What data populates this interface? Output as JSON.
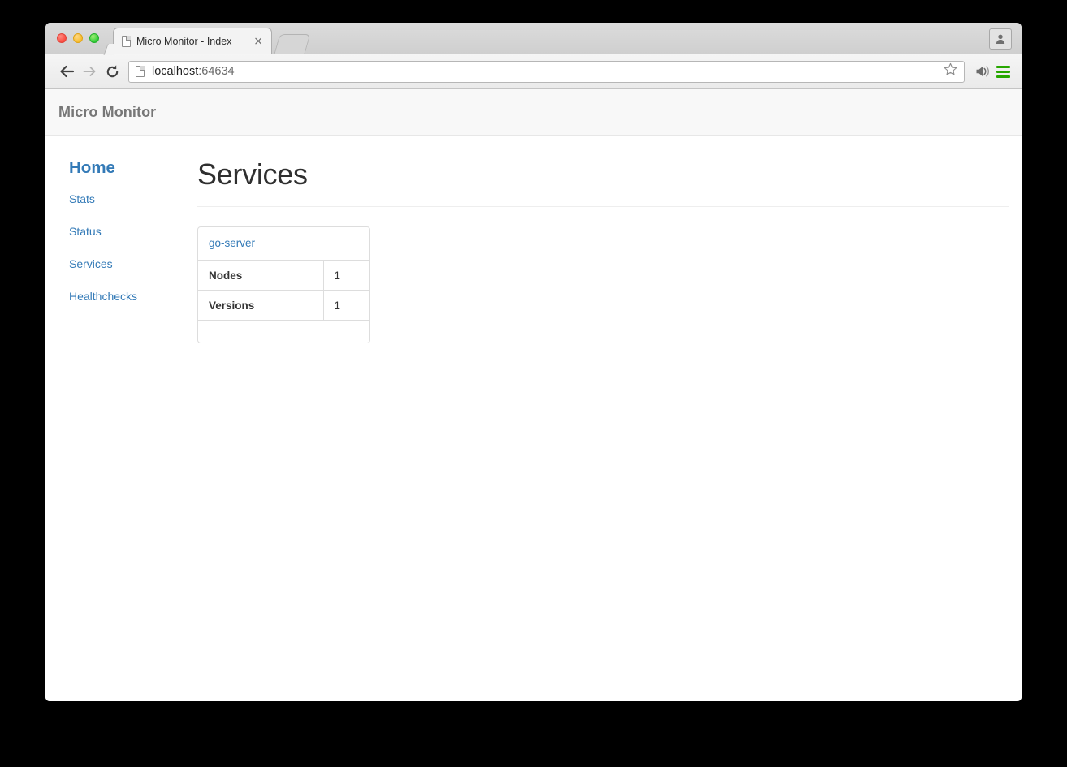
{
  "browser": {
    "tab": {
      "title": "Micro Monitor - Index",
      "close_label": "×",
      "page_icon": "page-icon"
    },
    "new_tab_label": "",
    "toolbar": {
      "back_icon": "back-arrow-icon",
      "forward_icon": "forward-arrow-icon",
      "reload_icon": "reload-icon",
      "url_host": "localhost",
      "url_port": ":64634",
      "url_full": "localhost:64634",
      "bookmark_icon": "star-icon",
      "cast_icon": "cast-icon",
      "menu_icon": "hamburger-menu-icon",
      "avatar_icon": "person-avatar-icon"
    },
    "accent_colors": {
      "menu_green": "#27a700",
      "traffic_red": "#fb4c41",
      "traffic_yellow": "#f7bd2e",
      "traffic_green": "#2ecc38"
    }
  },
  "app": {
    "brand": "Micro Monitor",
    "link_color": "#337ab7"
  },
  "sidebar": {
    "home": "Home",
    "items": [
      {
        "label": "Stats"
      },
      {
        "label": "Status"
      },
      {
        "label": "Services"
      },
      {
        "label": "Healthchecks"
      }
    ]
  },
  "main": {
    "title": "Services",
    "panels": [
      {
        "name": "go-server",
        "rows": [
          {
            "key": "Nodes",
            "value": "1"
          },
          {
            "key": "Versions",
            "value": "1"
          }
        ]
      }
    ]
  }
}
